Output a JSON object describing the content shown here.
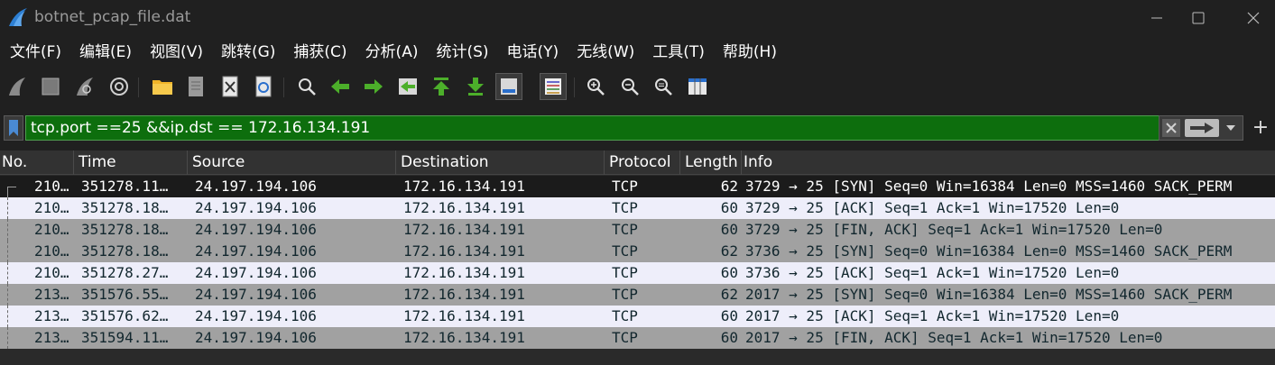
{
  "window": {
    "title": "botnet_pcap_file.dat",
    "app_icon": "shark-fin-icon"
  },
  "menu": [
    "文件(F)",
    "编辑(E)",
    "视图(V)",
    "跳转(G)",
    "捕获(C)",
    "分析(A)",
    "统计(S)",
    "电话(Y)",
    "无线(W)",
    "工具(T)",
    "帮助(H)"
  ],
  "toolbar": {
    "buttons": [
      "start-capture",
      "stop-capture",
      "restart-capture",
      "capture-options",
      "open-file",
      "save-file",
      "close-file",
      "reload-file",
      "find-packet",
      "go-back",
      "go-forward",
      "go-to-packet",
      "go-first",
      "go-last",
      "auto-scroll",
      "colorize",
      "zoom-in",
      "zoom-out",
      "zoom-normal",
      "resize-columns"
    ]
  },
  "filter": {
    "value": "tcp.port ==25 &&ip.dst == 172.16.134.191",
    "bg_color": "#0d6e0d"
  },
  "columns": [
    "No.",
    "Time",
    "Source",
    "Destination",
    "Protocol",
    "Length",
    "Info"
  ],
  "packets": [
    {
      "no": "210…",
      "time": "351278.11…",
      "source": "24.197.194.106",
      "destination": "172.16.134.191",
      "protocol": "TCP",
      "length": "62",
      "info": "3729 → 25 [SYN] Seq=0 Win=16384 Len=0 MSS=1460 SACK_PERM",
      "style": "sel"
    },
    {
      "no": "210…",
      "time": "351278.18…",
      "source": "24.197.194.106",
      "destination": "172.16.134.191",
      "protocol": "TCP",
      "length": "60",
      "info": "3729 → 25 [ACK] Seq=1 Ack=1 Win=17520 Len=0",
      "style": "hl"
    },
    {
      "no": "210…",
      "time": "351278.18…",
      "source": "24.197.194.106",
      "destination": "172.16.134.191",
      "protocol": "TCP",
      "length": "60",
      "info": "3729 → 25 [FIN, ACK] Seq=1 Ack=1 Win=17520 Len=0",
      "style": "gr"
    },
    {
      "no": "210…",
      "time": "351278.18…",
      "source": "24.197.194.106",
      "destination": "172.16.134.191",
      "protocol": "TCP",
      "length": "62",
      "info": "3736 → 25 [SYN] Seq=0 Win=16384 Len=0 MSS=1460 SACK_PERM",
      "style": "gr"
    },
    {
      "no": "210…",
      "time": "351278.27…",
      "source": "24.197.194.106",
      "destination": "172.16.134.191",
      "protocol": "TCP",
      "length": "60",
      "info": "3736 → 25 [ACK] Seq=1 Ack=1 Win=17520 Len=0",
      "style": "hl"
    },
    {
      "no": "213…",
      "time": "351576.55…",
      "source": "24.197.194.106",
      "destination": "172.16.134.191",
      "protocol": "TCP",
      "length": "62",
      "info": "2017 → 25 [SYN] Seq=0 Win=16384 Len=0 MSS=1460 SACK_PERM",
      "style": "gr"
    },
    {
      "no": "213…",
      "time": "351576.62…",
      "source": "24.197.194.106",
      "destination": "172.16.134.191",
      "protocol": "TCP",
      "length": "60",
      "info": "2017 → 25 [ACK] Seq=1 Ack=1 Win=17520 Len=0",
      "style": "hl"
    },
    {
      "no": "213…",
      "time": "351594.11…",
      "source": "24.197.194.106",
      "destination": "172.16.134.191",
      "protocol": "TCP",
      "length": "60",
      "info": "2017 → 25 [FIN, ACK] Seq=1 Ack=1 Win=17520 Len=0",
      "style": "gr"
    }
  ]
}
